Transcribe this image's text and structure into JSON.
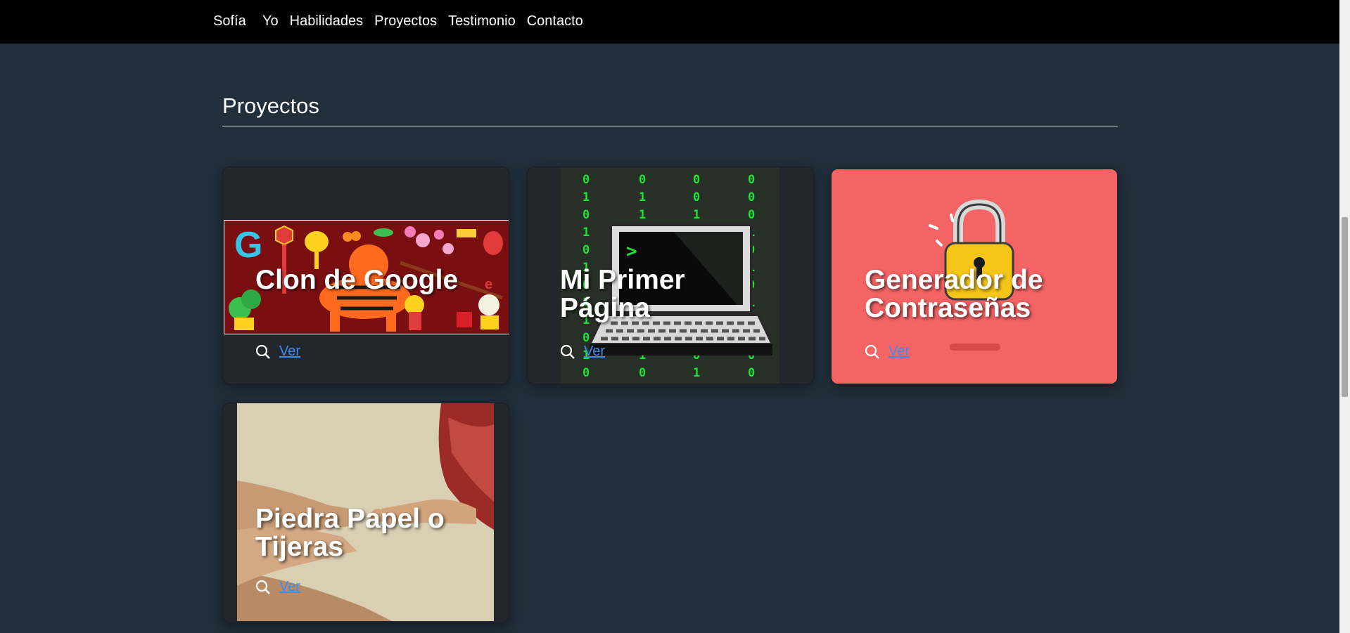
{
  "nav": {
    "brand": "Sofía",
    "links": [
      "Yo",
      "Habilidades",
      "Proyectos",
      "Testimonio",
      "Contacto"
    ]
  },
  "section": {
    "title": "Proyectos"
  },
  "projects": [
    {
      "title_lines": [
        "Clon de Google"
      ],
      "link_label": "Ver"
    },
    {
      "title_lines": [
        "Mi Primer",
        "Página"
      ],
      "link_label": "Ver"
    },
    {
      "title_lines": [
        "Generador de",
        "Contraseñas"
      ],
      "link_label": "Ver"
    },
    {
      "title_lines": [
        "Piedra Papel o",
        "Tijeras"
      ],
      "link_label": "Ver"
    }
  ],
  "colors": {
    "page_bg": "#212e3b",
    "navbar_bg": "#000000",
    "card_bg": "#22272d",
    "link": "#3b8df0",
    "lock_card_bg": "#f46464",
    "matrix_green": "#1ee236"
  },
  "icons": {
    "card_action": "search-icon"
  }
}
